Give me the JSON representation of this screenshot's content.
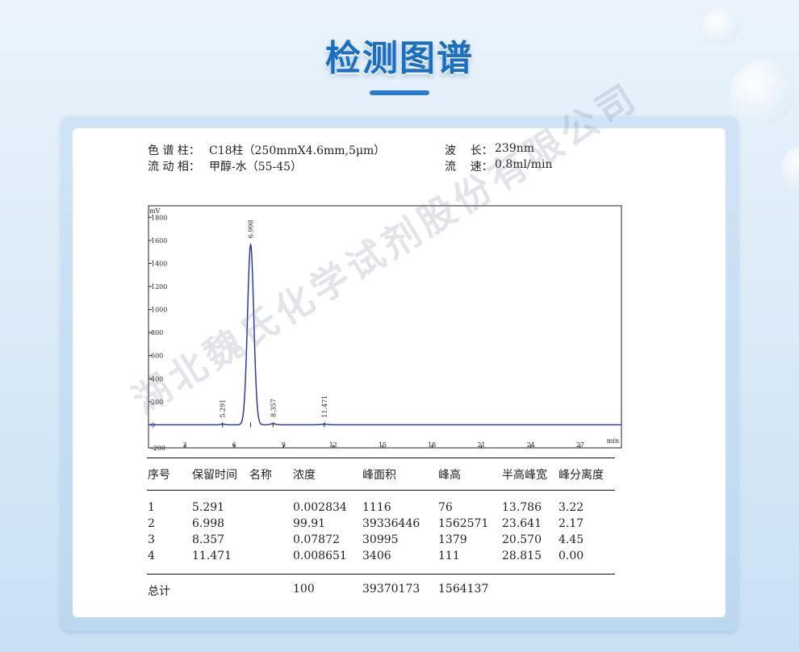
{
  "page_title": "检测图谱",
  "info": {
    "column_label": "色 谱 柱：",
    "column_value": "C18柱（250mmX4.6mm,5μm）",
    "mobile_label": "流 动 相：",
    "mobile_value": "甲醇-水（55-45）",
    "wavelength_label": "波    长：",
    "wavelength_value": "239nm",
    "flow_label": "流    速：",
    "flow_value": "0.8ml/min"
  },
  "chart_data": {
    "type": "line",
    "ylabel": "mV",
    "xlabel": "min",
    "xlim": [
      0.8,
      29.5
    ],
    "ylim": [
      -200,
      1900
    ],
    "y_ticks": [
      -200,
      0,
      200,
      400,
      600,
      800,
      1000,
      1200,
      1400,
      1600,
      1800
    ],
    "x_ticks": [
      3,
      6,
      9,
      12,
      15,
      18,
      21,
      24,
      27
    ],
    "peaks": [
      {
        "rt": 5.291,
        "label": "5.291",
        "height": 6,
        "sigma": 0.12
      },
      {
        "rt": 6.998,
        "label": "6.998",
        "height": 1562,
        "sigma": 0.19
      },
      {
        "rt": 8.357,
        "label": "8.357",
        "height": 10,
        "sigma": 0.15
      },
      {
        "rt": 11.471,
        "label": "11.471",
        "height": 5,
        "sigma": 0.2
      }
    ],
    "series_color": "#1f2fa6"
  },
  "table": {
    "headers": [
      "序号",
      "保留时间",
      "名称",
      "浓度",
      "峰面积",
      "峰高",
      "半高峰宽",
      "峰分离度"
    ],
    "rows": [
      [
        "1",
        "5.291",
        "",
        "0.002834",
        "1116",
        "76",
        "13.786",
        "3.22"
      ],
      [
        "2",
        "6.998",
        "",
        "99.91",
        "39336446",
        "1562571",
        "23.641",
        "2.17"
      ],
      [
        "3",
        "8.357",
        "",
        "0.07872",
        "30995",
        "1379",
        "20.570",
        "4.45"
      ],
      [
        "4",
        "11.471",
        "",
        "0.008651",
        "3406",
        "111",
        "28.815",
        "0.00"
      ]
    ],
    "total_label": "总计",
    "total_conc": "100",
    "total_area": "39370173",
    "total_height": "1564137"
  },
  "watermark": "湖北魏氏化学试剂股份有限公司"
}
